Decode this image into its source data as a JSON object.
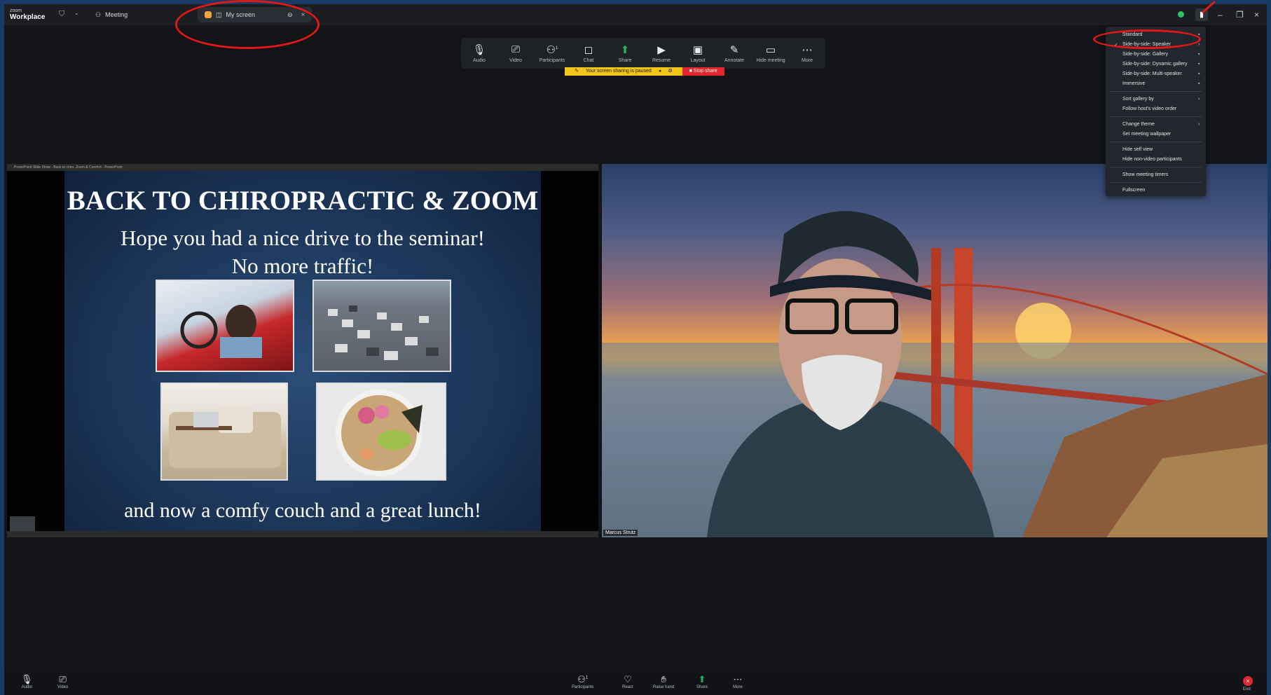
{
  "titlebar": {
    "brand_small": "zoom",
    "brand_large": "Workplace",
    "tab_meeting": "Meeting",
    "tab_screen": "My screen",
    "icons": [
      "shield-icon",
      "chevron-down-icon",
      "meeting-icon",
      "screen-icon",
      "pin-icon",
      "close-icon",
      "layout-icon",
      "minimize-icon",
      "restore-icon",
      "close-window-icon"
    ]
  },
  "toolbar": {
    "audio": "Audio",
    "video": "Video",
    "participants": "Participants",
    "participants_count": "1",
    "chat": "Chat",
    "share": "Share",
    "resume": "Resume",
    "layout": "Layout",
    "annotate": "Annotate",
    "hide_meeting": "Hide meeting",
    "more": "More"
  },
  "share_status": {
    "paused_text": "Your screen sharing is paused",
    "stop_label": "Stop share",
    "paused_color": "#f0c419",
    "stop_color": "#e2272e"
  },
  "shared_window_title": "PowerPoint Slide Show - Back to chiro, Zoom & Comfort - PowerPoint",
  "slide": {
    "title": "BACK TO CHIROPRACTIC & ZOOM",
    "line1": "Hope you had a nice drive to the seminar!",
    "line2": "No more traffic!",
    "footer": "and now a comfy couch and a great lunch!"
  },
  "video": {
    "participant_name": "Marcus Strutz"
  },
  "view_menu": {
    "items": [
      "Standard",
      "Side-by-side: Speaker",
      "Side-by-side: Gallery",
      "Side-by-side: Dynamic gallery",
      "Side-by-side: Multi-speaker",
      "Immersive",
      "Sort gallery by",
      "Follow host's video order",
      "Change theme",
      "Set meeting wallpaper",
      "Hide self view",
      "Hide non-video participants",
      "Show meeting timers",
      "Fullscreen"
    ],
    "checked_item": "Side-by-side: Speaker",
    "check_mark": "✓",
    "submenu_arrow": "›"
  },
  "bottombar": {
    "audio": "Audio",
    "video": "Video",
    "participants": "Participants",
    "participants_count": "1",
    "react": "React",
    "raise_hand": "Raise hand",
    "share": "Share",
    "more": "More",
    "end": "End"
  },
  "colors": {
    "annotation_ring": "#e01818",
    "share_green": "#21b35a",
    "status_green": "#2ec16b"
  }
}
